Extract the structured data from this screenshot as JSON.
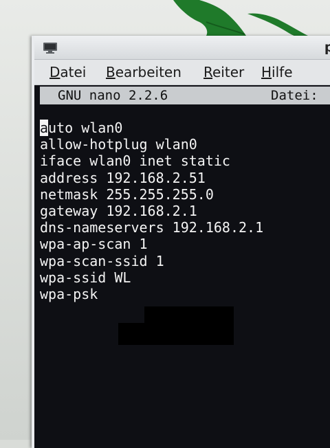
{
  "window": {
    "title": "pi",
    "menu": [
      {
        "mnemonic": "D",
        "rest": "atei"
      },
      {
        "mnemonic": "B",
        "rest": "earbeiten"
      },
      {
        "mnemonic": "R",
        "rest": "eiter"
      },
      {
        "mnemonic": "H",
        "rest": "ilfe"
      }
    ]
  },
  "editor": {
    "header_version": "GNU nano 2.2.6",
    "header_file": "Datei:",
    "cursor_char": "a",
    "lines": [
      "uto wlan0",
      "allow-hotplug wlan0",
      "iface wlan0 inet static",
      "address 192.168.2.51",
      "netmask 255.255.255.0",
      "gateway 192.168.2.1",
      "dns-nameservers 192.168.2.1",
      "wpa-ap-scan 1",
      "wpa-scan-ssid 1",
      "wpa-ssid WL",
      "wpa-psk"
    ]
  },
  "colors": {
    "terminal_background": "#0e0f14",
    "terminal_text": "#f4f4f4",
    "header_bar": "#c9cccf",
    "leaf": "#1f7a2a"
  },
  "icons": {
    "window_icon": "terminal-icon"
  }
}
